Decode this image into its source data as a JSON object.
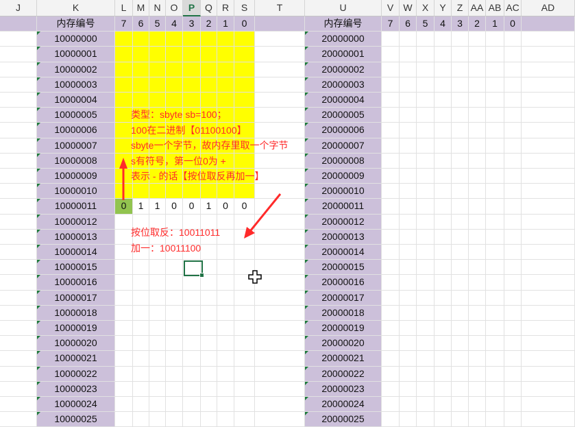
{
  "columns": [
    "J",
    "K",
    "L",
    "M",
    "N",
    "O",
    "P",
    "Q",
    "R",
    "S",
    "T",
    "U",
    "V",
    "W",
    "X",
    "Y",
    "Z",
    "AA",
    "AB",
    "AC",
    "AD"
  ],
  "selected_column": "P",
  "header_row": {
    "k_label": "内存编号",
    "bits": [
      "7",
      "6",
      "5",
      "4",
      "3",
      "2",
      "1",
      "0"
    ],
    "u_label": "内存编号",
    "bits_right": [
      "7",
      "6",
      "5",
      "4",
      "3",
      "2",
      "1",
      "0"
    ]
  },
  "addresses_k": [
    "10000000",
    "10000001",
    "10000002",
    "10000003",
    "10000004",
    "10000005",
    "10000006",
    "10000007",
    "10000008",
    "10000009",
    "10000010",
    "10000011",
    "10000012",
    "10000013",
    "10000014",
    "10000015",
    "10000016",
    "10000017",
    "10000018",
    "10000019",
    "10000020",
    "10000021",
    "10000022",
    "10000023",
    "10000024",
    "10000025"
  ],
  "addresses_u": [
    "20000000",
    "20000001",
    "20000002",
    "20000003",
    "20000004",
    "20000005",
    "20000006",
    "20000007",
    "20000008",
    "20000009",
    "20000010",
    "20000011",
    "20000012",
    "20000013",
    "20000014",
    "20000015",
    "20000016",
    "20000017",
    "20000018",
    "20000019",
    "20000020",
    "20000021",
    "20000022",
    "20000023",
    "20000024",
    "20000025"
  ],
  "bit_row_values": [
    "0",
    "1",
    "1",
    "0",
    "0",
    "1",
    "0",
    "0"
  ],
  "annotation_main": [
    "类型：sbyte sb=100；",
    "100在二进制【01100100】",
    "sbyte一个字节，故内存里取一个字节",
    "s有符号，第一位0为 +",
    "表示 - 的话【按位取反再加一】"
  ],
  "annotation_lower": [
    "按位取反：10011011",
    "加一：10011100"
  ],
  "colors": {
    "lavender": "#ccc0da",
    "yellow": "#ffff00",
    "green": "#92c44f",
    "annotation": "#ff2a2a",
    "excel_green": "#217346"
  }
}
